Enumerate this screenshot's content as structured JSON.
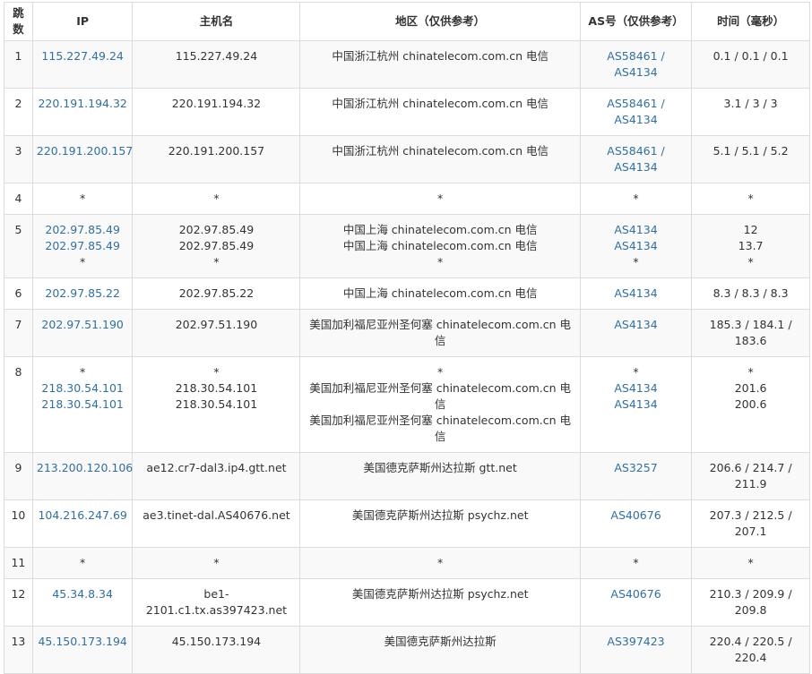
{
  "headers": {
    "hop": [
      "跳",
      "数"
    ],
    "ip": "IP",
    "hostname": "主机名",
    "location": "地区（仅供参考）",
    "as": "AS号（仅供参考）",
    "time": "时间（毫秒）"
  },
  "rows": [
    {
      "hop": "1",
      "ip": [
        "115.227.49.24"
      ],
      "host": [
        "115.227.49.24"
      ],
      "loc": [
        "中国浙江杭州 chinatelecom.com.cn 电信"
      ],
      "as": [
        "AS58461 /",
        "AS4134"
      ],
      "time": [
        "0.1 / 0.1 / 0.1"
      ]
    },
    {
      "hop": "2",
      "ip": [
        "220.191.194.32"
      ],
      "host": [
        "220.191.194.32"
      ],
      "loc": [
        "中国浙江杭州 chinatelecom.com.cn 电信"
      ],
      "as": [
        "AS58461 /",
        "AS4134"
      ],
      "time": [
        "3.1 / 3 / 3"
      ]
    },
    {
      "hop": "3",
      "ip": [
        "220.191.200.157"
      ],
      "host": [
        "220.191.200.157"
      ],
      "loc": [
        "中国浙江杭州 chinatelecom.com.cn 电信"
      ],
      "as": [
        "AS58461 /",
        "AS4134"
      ],
      "time": [
        "5.1 / 5.1 / 5.2"
      ]
    },
    {
      "hop": "4",
      "ip": [
        "*"
      ],
      "host": [
        "*"
      ],
      "loc": [
        "*"
      ],
      "as": [
        "*"
      ],
      "time": [
        "*"
      ]
    },
    {
      "hop": "5",
      "ip": [
        "202.97.85.49",
        "202.97.85.49",
        "*"
      ],
      "host": [
        "202.97.85.49",
        "202.97.85.49",
        "*"
      ],
      "loc": [
        "中国上海 chinatelecom.com.cn 电信",
        "中国上海 chinatelecom.com.cn 电信",
        "*"
      ],
      "as": [
        "AS4134",
        "AS4134",
        "*"
      ],
      "time": [
        "12",
        "13.7",
        "*"
      ]
    },
    {
      "hop": "6",
      "ip": [
        "202.97.85.22"
      ],
      "host": [
        "202.97.85.22"
      ],
      "loc": [
        "中国上海 chinatelecom.com.cn 电信"
      ],
      "as": [
        "AS4134"
      ],
      "time": [
        "8.3 / 8.3 / 8.3"
      ]
    },
    {
      "hop": "7",
      "ip": [
        "202.97.51.190"
      ],
      "host": [
        "202.97.51.190"
      ],
      "loc": [
        "美国加利福尼亚州圣何塞 chinatelecom.com.cn 电",
        "信"
      ],
      "as": [
        "AS4134"
      ],
      "time": [
        "185.3 / 184.1 /",
        "183.6"
      ]
    },
    {
      "hop": "8",
      "ip": [
        "*",
        "218.30.54.101",
        "218.30.54.101"
      ],
      "host": [
        "*",
        "218.30.54.101",
        "218.30.54.101"
      ],
      "loc": [
        "*",
        "美国加利福尼亚州圣何塞 chinatelecom.com.cn 电",
        "信",
        "美国加利福尼亚州圣何塞 chinatelecom.com.cn 电",
        "信"
      ],
      "as": [
        "*",
        "AS4134",
        "AS4134"
      ],
      "time": [
        "*",
        "201.6",
        "200.6"
      ]
    },
    {
      "hop": "9",
      "ip": [
        "213.200.120.106"
      ],
      "host": [
        "ae12.cr7-dal3.ip4.gtt.net"
      ],
      "loc": [
        "美国德克萨斯州达拉斯 gtt.net"
      ],
      "as": [
        "AS3257"
      ],
      "time": [
        "206.6 / 214.7 /",
        "211.9"
      ]
    },
    {
      "hop": "10",
      "ip": [
        "104.216.247.69"
      ],
      "host": [
        "ae3.tinet-dal.AS40676.net"
      ],
      "loc": [
        "美国德克萨斯州达拉斯 psychz.net"
      ],
      "as": [
        "AS40676"
      ],
      "time": [
        "207.3 / 212.5 /",
        "207.1"
      ]
    },
    {
      "hop": "11",
      "ip": [
        "*"
      ],
      "host": [
        "*"
      ],
      "loc": [
        "*"
      ],
      "as": [
        "*"
      ],
      "time": [
        "*"
      ]
    },
    {
      "hop": "12",
      "ip": [
        "45.34.8.34"
      ],
      "host": [
        "be1-",
        "2101.c1.tx.as397423.net"
      ],
      "loc": [
        "美国德克萨斯州达拉斯 psychz.net"
      ],
      "as": [
        "AS40676"
      ],
      "time": [
        "210.3 / 209.9 /",
        "209.8"
      ]
    },
    {
      "hop": "13",
      "ip": [
        "45.150.173.194"
      ],
      "host": [
        "45.150.173.194"
      ],
      "loc": [
        "美国德克萨斯州达拉斯"
      ],
      "as": [
        "AS397423"
      ],
      "time": [
        "220.4 / 220.5 /",
        "220.4"
      ]
    }
  ]
}
